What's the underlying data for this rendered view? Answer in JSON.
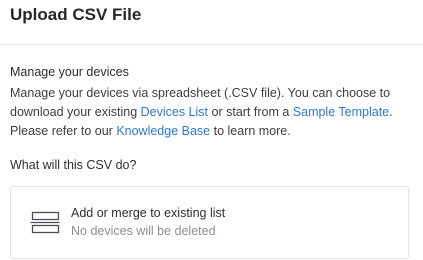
{
  "dialog": {
    "title": "Upload CSV File"
  },
  "manage": {
    "heading": "Manage your devices",
    "line1": "Manage your devices via spreadsheet (.CSV file). You can choose to",
    "line2_pre": "download your existing ",
    "devices_list_link": "Devices List",
    "line2_mid": " or start from a ",
    "sample_template_link": "Sample Template",
    "line2_post": ".",
    "line3_pre": "Please refer to our ",
    "knowledge_base_link": "Knowledge Base",
    "line3_post": " to learn more."
  },
  "csv_action": {
    "heading": "What will this CSV do?",
    "option": {
      "icon": "merge-list-icon",
      "label": "Add or merge to existing list",
      "sublabel": "No devices will be deleted"
    }
  },
  "colors": {
    "link": "#2f79c9",
    "muted": "#8a9097",
    "border": "#e1e4e8"
  }
}
